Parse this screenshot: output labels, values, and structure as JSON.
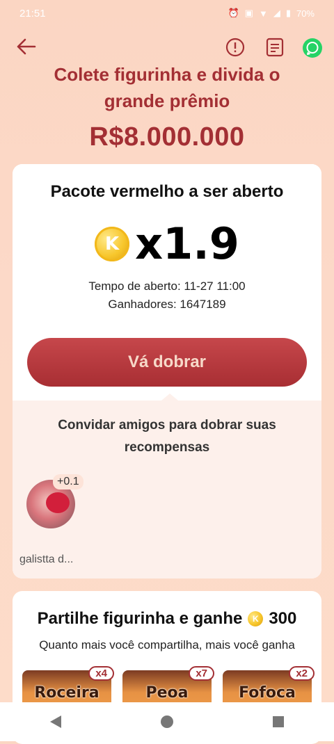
{
  "status_bar": {
    "time": "21:51",
    "battery": "70%"
  },
  "header": {
    "title_line1": "Colete figurinha e divida o",
    "title_line2": "grande prêmio",
    "prize": "R$8.000.000"
  },
  "red_packet": {
    "title": "Pacote vermelho a ser aberto",
    "coin_letter": "K",
    "multiplier": "x1.9",
    "open_time": "Tempo de aberto: 11-27 11:00",
    "winners": "Ganhadores: 1647189",
    "double_button": "Vá dobrar"
  },
  "invite": {
    "text_line1": "Convidar amigos para dobrar suas",
    "text_line2": "recompensas",
    "friends": [
      {
        "name": "galistta d...",
        "bonus": "+0.1"
      }
    ]
  },
  "share": {
    "title": "Partilhe figurinha e ganhe",
    "coin_letter": "K",
    "amount": "300",
    "subtitle": "Quanto mais você compartilha, mais você ganha",
    "stickers": [
      {
        "label": "Roceira",
        "count": "x4"
      },
      {
        "label": "Peoa",
        "count": "x7"
      },
      {
        "label": "Fofoca",
        "count": "x2"
      }
    ]
  },
  "colors": {
    "accent": "#a32f34",
    "background": "#fcd9c8",
    "whatsapp": "#25d366"
  },
  "icons": [
    "back-arrow-icon",
    "info-icon",
    "document-icon",
    "whatsapp-icon",
    "coin-icon"
  ]
}
